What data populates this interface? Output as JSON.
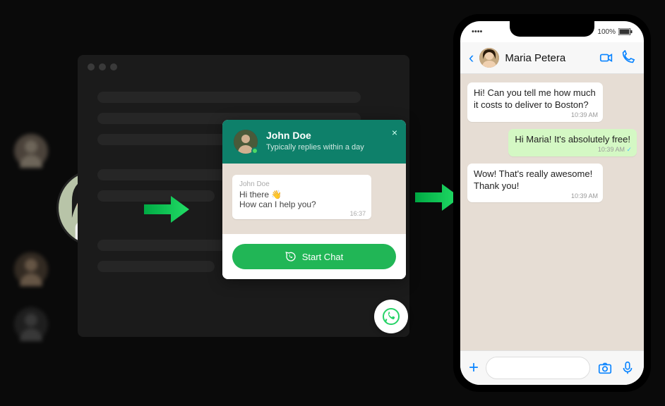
{
  "widget": {
    "name": "John Doe",
    "subtitle": "Typically replies within a day",
    "close_label": "×",
    "message": {
      "sender": "John Doe",
      "line1": "Hi there 👋",
      "line2": "How can I help you?",
      "time": "16:37"
    },
    "start_button": "Start Chat"
  },
  "phone": {
    "status": {
      "battery": "100%"
    },
    "contact_name": "Maria Petera",
    "messages": [
      {
        "dir": "in",
        "text": "Hi! Can you tell me how much it costs to deliver to Boston?",
        "time": "10:39 AM"
      },
      {
        "dir": "out",
        "text": "Hi Maria! It's absolutely free!",
        "time": "10:39 AM"
      },
      {
        "dir": "in",
        "text": "Wow! That's really awesome! Thank you!",
        "time": "10:39 AM"
      }
    ]
  }
}
